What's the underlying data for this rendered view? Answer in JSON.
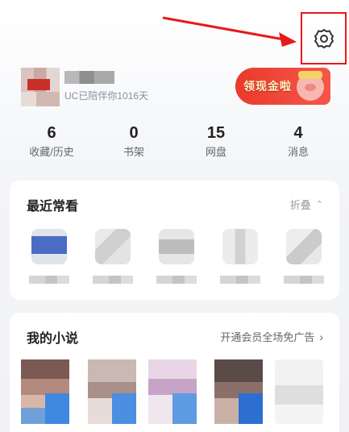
{
  "profile": {
    "days_text": "UC已陪伴你1016天"
  },
  "banner": {
    "text": "领现金啦"
  },
  "stats": [
    {
      "num": "6",
      "label": "收藏/历史"
    },
    {
      "num": "0",
      "label": "书架"
    },
    {
      "num": "15",
      "label": "网盘"
    },
    {
      "num": "4",
      "label": "消息"
    }
  ],
  "recent": {
    "title": "最近常看",
    "action": "折叠",
    "action_icon": "double-chevron-up-icon"
  },
  "novels": {
    "title": "我的小说",
    "action": "开通会员全场免广告",
    "action_icon": "chevron-right-icon"
  },
  "colors": {
    "annotation_red": "#e8191b",
    "banner_red": "#e93a2c",
    "card_bg": "#ffffff",
    "page_bg": "#f0f2f5"
  },
  "icons": {
    "settings": "gear-icon"
  }
}
